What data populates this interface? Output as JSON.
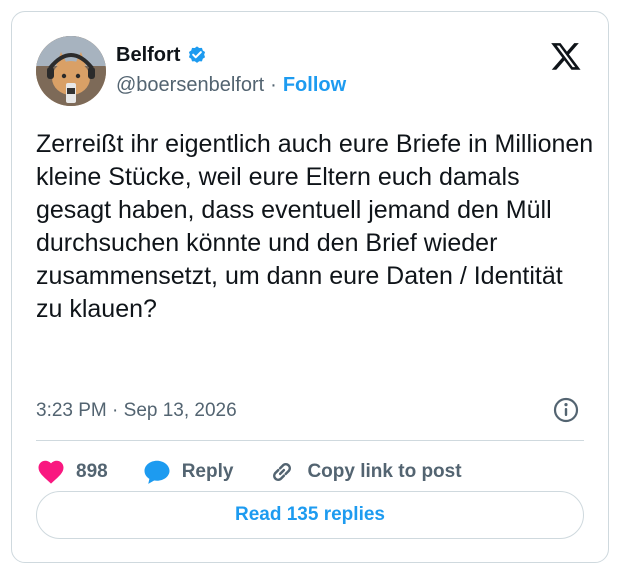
{
  "author": {
    "display_name": "Belfort",
    "handle": "@boersenbelfort",
    "separator": "·",
    "follow_label": "Follow",
    "verified": true
  },
  "tweet": {
    "text": "Zerreißt ihr eigentlich auch eure Briefe in Millionen kleine Stücke, weil eure Eltern euch damals gesagt haben, dass eventuell jemand den Müll durchsuchen könnte und den Brief wieder zusammensetzt, um dann eure Daten / Identität zu klauen?",
    "timestamp": "3:23 PM · Sep 13, 2026"
  },
  "actions": {
    "like_count": "898",
    "reply_label": "Reply",
    "copy_link_label": "Copy link to post"
  },
  "read_replies_label": "Read 135 replies",
  "icons": {
    "brand": "x-logo-icon",
    "verified": "verified-badge-icon",
    "info": "info-icon",
    "like": "heart-icon",
    "reply": "speech-bubble-icon",
    "copy": "link-icon"
  },
  "colors": {
    "accent": "#1d9bf0",
    "like": "#f91880",
    "text": "#0f1419",
    "muted": "#536471",
    "border": "#cfd9de"
  }
}
